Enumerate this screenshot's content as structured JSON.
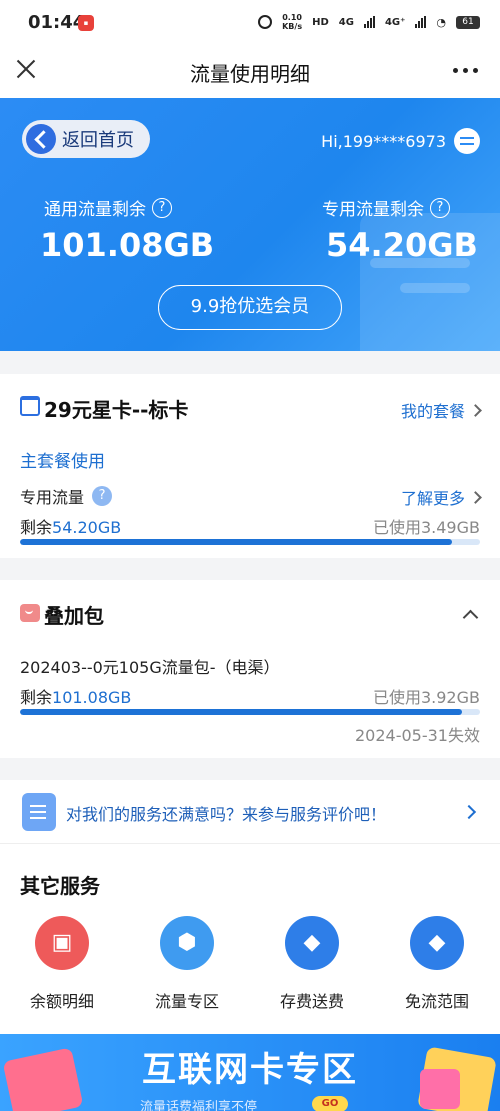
{
  "status": {
    "time": "01:44",
    "net_speed_value": "0.10",
    "net_speed_unit": "KB/s",
    "hd_tag": "HD",
    "net1": "4G",
    "net2": "4G⁺",
    "battery": "61"
  },
  "nav": {
    "title": "流量使用明细"
  },
  "hero": {
    "back_label": "返回首页",
    "user": "Hi,199****6973",
    "general_label": "通用流量剩余",
    "general_value": "101.08GB",
    "special_label": "专用流量剩余",
    "special_value": "54.20GB",
    "vip_button": "9.9抢优选会员",
    "help_glyph": "?"
  },
  "plan": {
    "name": "29元星卡--标卡",
    "my_plan_link": "我的套餐",
    "section": "主套餐使用",
    "row_label": "专用流量",
    "learn_more": "了解更多",
    "remain_prefix": "剩余",
    "remain_value": "54.20GB",
    "used": "已使用3.49GB",
    "remain_fraction": 0.94
  },
  "addon": {
    "title": "叠加包",
    "package_name": "202403--0元105G流量包-（电渠）",
    "remain_prefix": "剩余",
    "remain_value": "101.08GB",
    "used": "已使用3.92GB",
    "expire": "2024-05-31失效",
    "remain_fraction": 0.96
  },
  "feedback": {
    "text": "对我们的服务还满意吗？来参与服务评价吧！"
  },
  "services": {
    "title": "其它服务",
    "items": [
      {
        "label": "余额明细",
        "icon": "briefcase-icon",
        "color": "#ee5a5a"
      },
      {
        "label": "流量专区",
        "icon": "cube-icon",
        "color": "#3f9bf0"
      },
      {
        "label": "存费送费",
        "icon": "tag-icon",
        "color": "#2e7ee8"
      },
      {
        "label": "免流范围",
        "icon": "tag-icon",
        "color": "#2e7ee8"
      }
    ]
  },
  "banner": {
    "title": "互联网卡专区",
    "subtitle": "流量话费福利享不停",
    "go": "GO"
  },
  "colors": {
    "primary": "#1e86ee",
    "link": "#1e6fd0",
    "progress": "#1d72d6"
  }
}
